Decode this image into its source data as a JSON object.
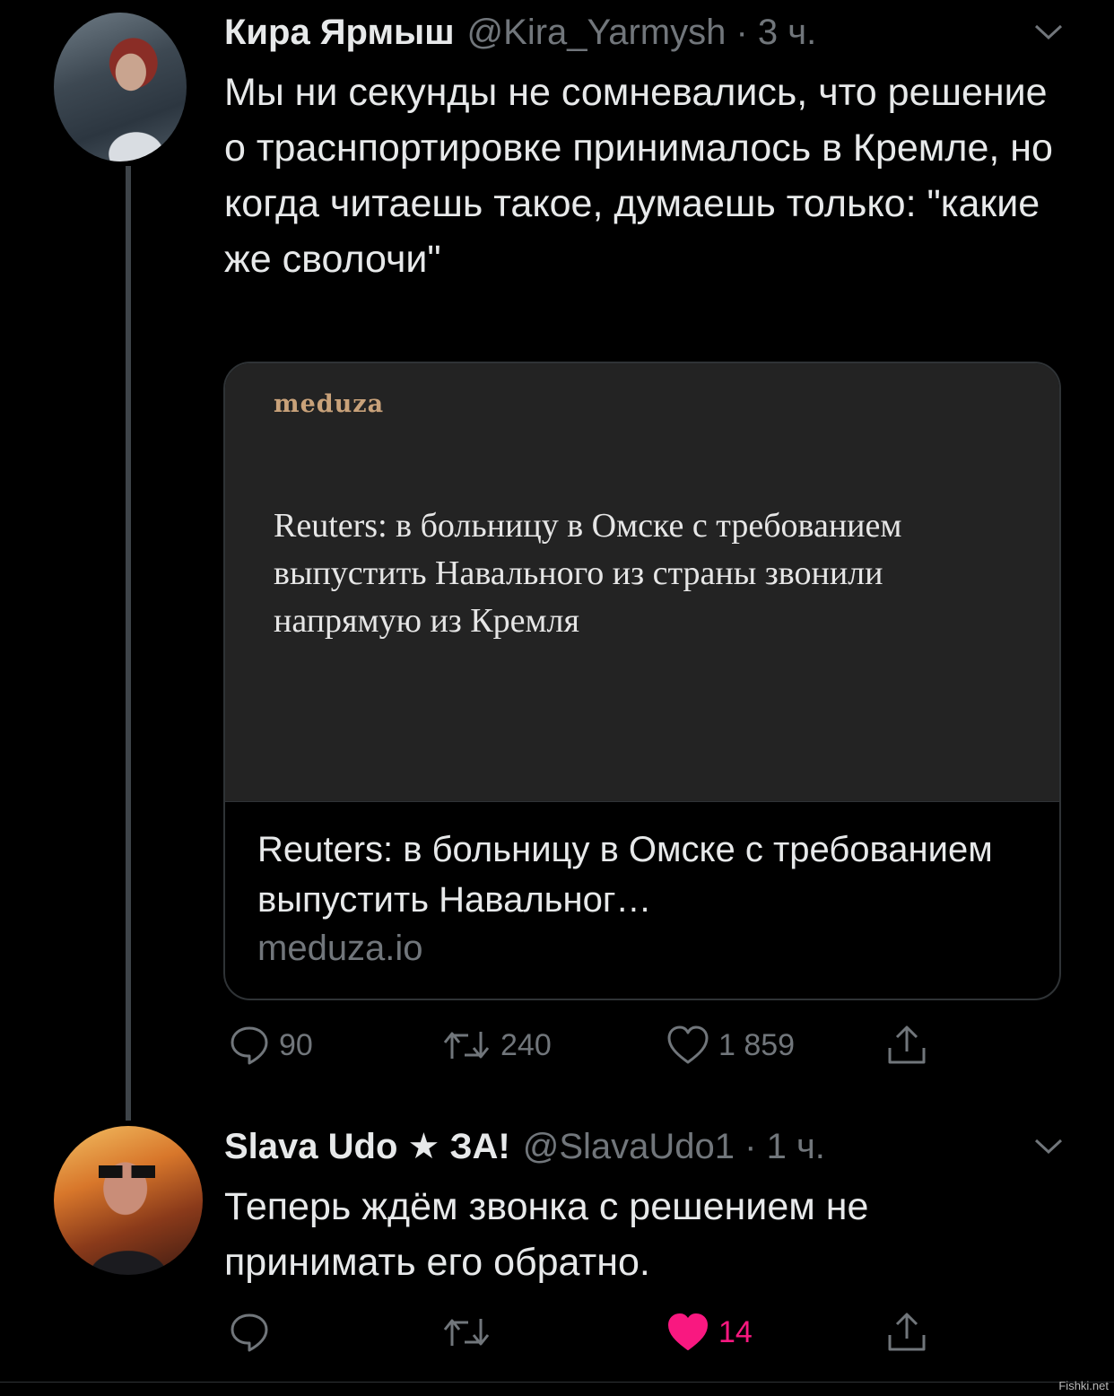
{
  "tweets": [
    {
      "author": "Кира Ярмыш",
      "meta": "@Kira_Yarmysh · 3 ч.",
      "text": "Мы ни секунды не сомневались, что решение о траснпортировке принималось в Кремле, но когда читаешь такое, думаешь только: \"какие же сволочи\"",
      "card": {
        "logo": "meduza",
        "headline": "Reuters: в больницу в Омске с требованием выпустить Навального из страны звонили напрямую из Кремля",
        "title": "Reuters: в больницу в Омске с требованием выпустить Навальног…",
        "domain": "meduza.io"
      },
      "actions": {
        "replies": "90",
        "retweets": "240",
        "likes": "1 859"
      }
    },
    {
      "author": "Slava Udo ★ ЗА!",
      "meta": "@SlavaUdo1 · 1 ч.",
      "text": "Теперь ждём звонка с решением не принимать его обратно.",
      "actions": {
        "replies": "",
        "retweets": "",
        "likes": "14"
      },
      "liked_color": "#f91880"
    }
  ],
  "watermark": "Fishki.net"
}
